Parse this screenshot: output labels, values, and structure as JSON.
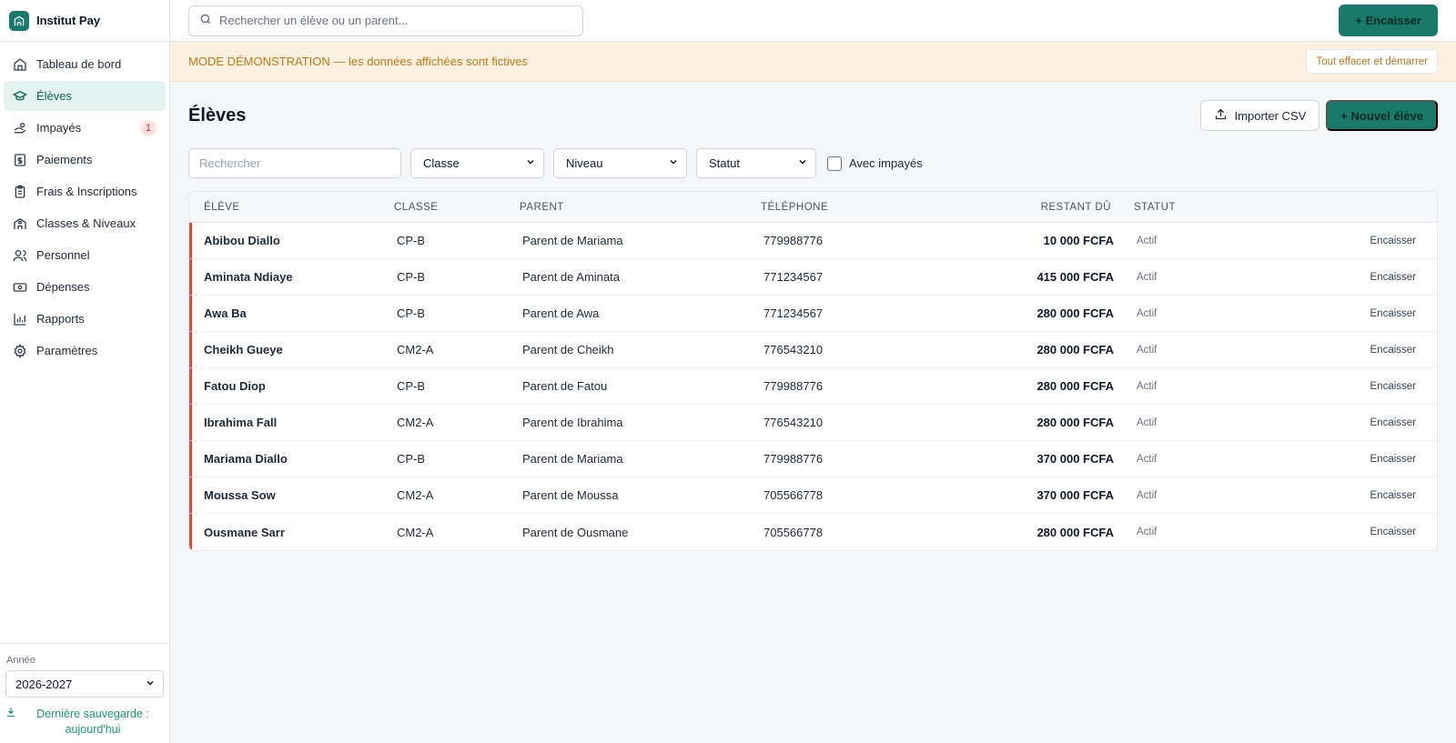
{
  "brand": {
    "name": "Institut Pay"
  },
  "sidebar": {
    "items": [
      {
        "label": "Tableau de bord",
        "icon": "home-icon",
        "active": false
      },
      {
        "label": "Élèves",
        "icon": "graduation-cap-icon",
        "active": true
      },
      {
        "label": "Impayés",
        "icon": "hand-coins-icon",
        "active": false,
        "badge": "1"
      },
      {
        "label": "Paiements",
        "icon": "receipt-icon",
        "active": false
      },
      {
        "label": "Frais & Inscriptions",
        "icon": "clipboard-icon",
        "active": false
      },
      {
        "label": "Classes & Niveaux",
        "icon": "school-icon",
        "active": false
      },
      {
        "label": "Personnel",
        "icon": "users-icon",
        "active": false
      },
      {
        "label": "Dépenses",
        "icon": "banknote-icon",
        "active": false
      },
      {
        "label": "Rapports",
        "icon": "bar-chart-icon",
        "active": false
      },
      {
        "label": "Paramètres",
        "icon": "gear-icon",
        "active": false
      }
    ],
    "year_label": "Année",
    "year_value": "2026-2027",
    "backup_text": "Dernière sauvegarde : aujourd'hui"
  },
  "topbar": {
    "search_placeholder": "Rechercher un élève ou un parent...",
    "cash_button": "+ Encaisser"
  },
  "demo": {
    "text": "MODE DÉMONSTRATION — les données affichées sont fictives",
    "reset_button": "Tout effacer et démarrer"
  },
  "page": {
    "title": "Élèves",
    "import_button": "Importer CSV",
    "new_button": "+ Nouvel élève"
  },
  "filters": {
    "search_placeholder": "Rechercher",
    "classe": "Classe",
    "niveau": "Niveau",
    "statut": "Statut",
    "unpaid_label": "Avec impayés"
  },
  "table": {
    "headers": [
      "ÉLÈVE",
      "CLASSE",
      "PARENT",
      "TÉLÉPHONE",
      "RESTANT DÛ",
      "STATUT"
    ],
    "rows": [
      {
        "eleve": "Abibou Diallo",
        "classe": "CP-B",
        "parent": "Parent de Mariama",
        "telephone": "779988776",
        "restant": "10 000 FCFA",
        "statut": "Actif",
        "action": "Encaisser"
      },
      {
        "eleve": "Aminata Ndiaye",
        "classe": "CP-B",
        "parent": "Parent de Aminata",
        "telephone": "771234567",
        "restant": "415 000 FCFA",
        "statut": "Actif",
        "action": "Encaisser"
      },
      {
        "eleve": "Awa Ba",
        "classe": "CP-B",
        "parent": "Parent de Awa",
        "telephone": "771234567",
        "restant": "280 000 FCFA",
        "statut": "Actif",
        "action": "Encaisser"
      },
      {
        "eleve": "Cheikh Gueye",
        "classe": "CM2-A",
        "parent": "Parent de Cheikh",
        "telephone": "776543210",
        "restant": "280 000 FCFA",
        "statut": "Actif",
        "action": "Encaisser"
      },
      {
        "eleve": "Fatou Diop",
        "classe": "CP-B",
        "parent": "Parent de Fatou",
        "telephone": "779988776",
        "restant": "280 000 FCFA",
        "statut": "Actif",
        "action": "Encaisser"
      },
      {
        "eleve": "Ibrahima Fall",
        "classe": "CM2-A",
        "parent": "Parent de Ibrahima",
        "telephone": "776543210",
        "restant": "280 000 FCFA",
        "statut": "Actif",
        "action": "Encaisser"
      },
      {
        "eleve": "Mariama Diallo",
        "classe": "CP-B",
        "parent": "Parent de Mariama",
        "telephone": "779988776",
        "restant": "370 000 FCFA",
        "statut": "Actif",
        "action": "Encaisser"
      },
      {
        "eleve": "Moussa Sow",
        "classe": "CM2-A",
        "parent": "Parent de Moussa",
        "telephone": "705566778",
        "restant": "370 000 FCFA",
        "statut": "Actif",
        "action": "Encaisser"
      },
      {
        "eleve": "Ousmane Sarr",
        "classe": "CM2-A",
        "parent": "Parent de Ousmane",
        "telephone": "705566778",
        "restant": "280 000 FCFA",
        "statut": "Actif",
        "action": "Encaisser"
      }
    ]
  },
  "colors": {
    "accent": "#1a7a6a",
    "active_bg": "#e4f3ef",
    "demo_bg": "#fcf1e0",
    "demo_text": "#c07a12",
    "unpaid_marker": "#e04a3a",
    "badge_text": "#dc2626"
  }
}
